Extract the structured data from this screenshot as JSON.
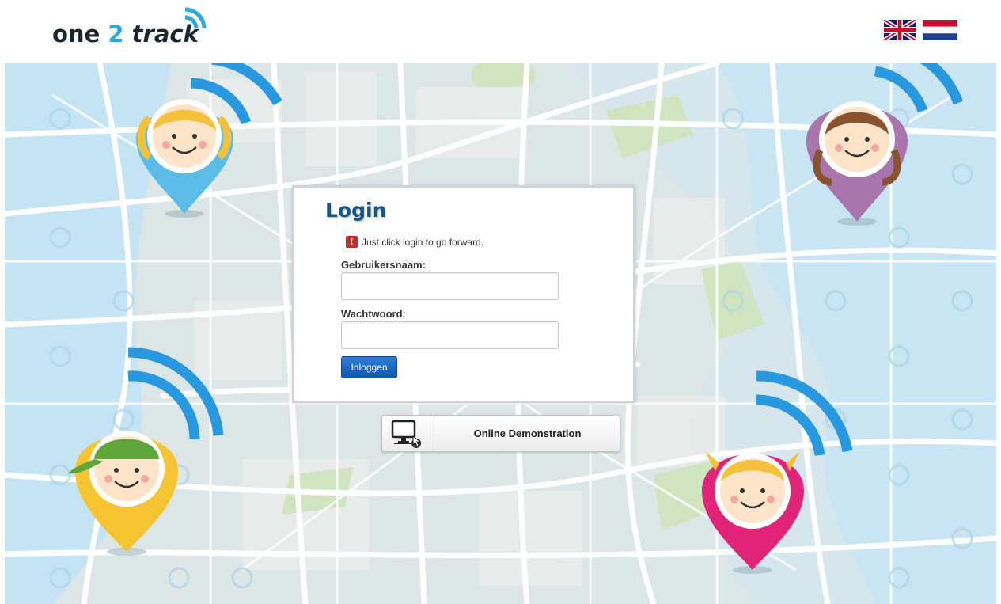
{
  "brand": {
    "logo_one": "one",
    "logo_two": "2",
    "logo_track": "track",
    "accent_color": "#2da7e0",
    "text_color": "#1b2430"
  },
  "languages": [
    {
      "name": "uk-flag-icon",
      "label": "English"
    },
    {
      "name": "nl-flag-icon",
      "label": "Nederlands"
    }
  ],
  "login": {
    "title": "Login",
    "info_icon": "info-icon",
    "info_text": "Just click login to go forward.",
    "username_label": "Gebruikersnaam:",
    "username_value": "",
    "password_label": "Wachtwoord:",
    "password_value": "",
    "submit_label": "Inloggen",
    "title_color": "#14568c",
    "button_color": "#1763c4"
  },
  "demo": {
    "icon": "monitor-pointer-icon",
    "label": "Online Demonstration"
  },
  "background": {
    "type": "city-map-illustration",
    "water_color": "#bcdff3",
    "road_color": "#ffffff",
    "park_color": "#c9e2b8",
    "characters": [
      {
        "icon": "girl-pigtails-pin-icon",
        "color": "#5bbce8"
      },
      {
        "icon": "girl-brown-hair-pin-icon",
        "color": "#a876ad"
      },
      {
        "icon": "boy-cap-pin-icon",
        "color": "#f6c431"
      },
      {
        "icon": "girl-blonde-pin-icon",
        "color": "#e1247a"
      }
    ]
  }
}
